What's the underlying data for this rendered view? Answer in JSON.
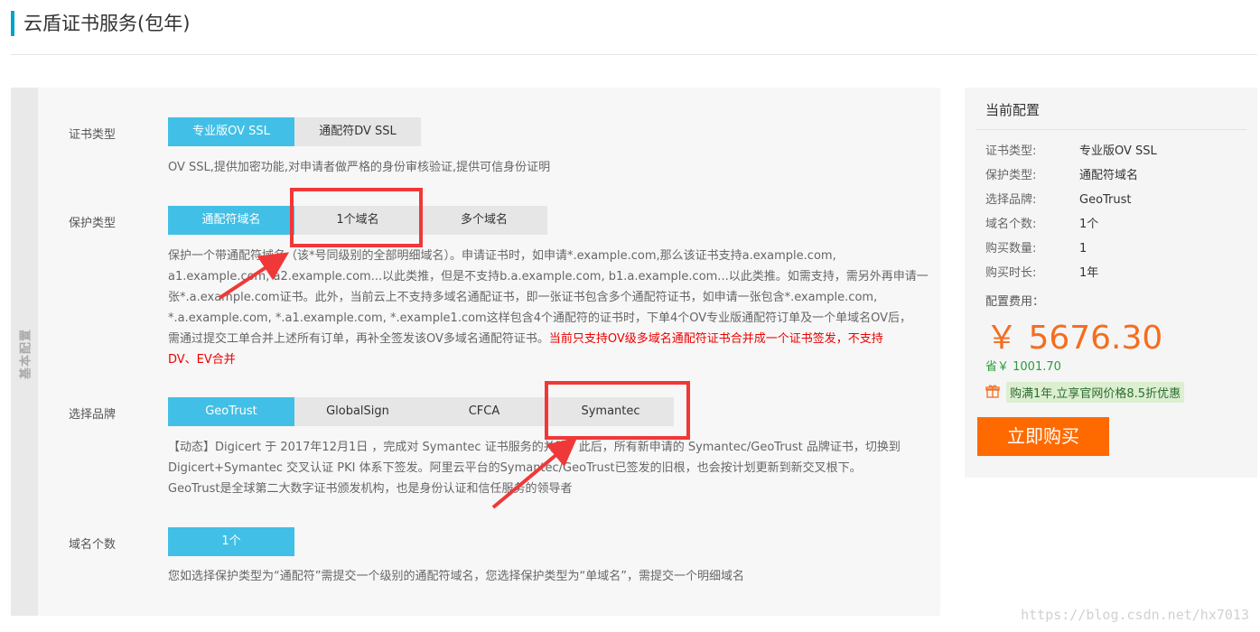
{
  "page": {
    "title": "云盾证书服务(包年)"
  },
  "panel": {
    "side_label": "基本配置"
  },
  "cert_type": {
    "label": "证书类型",
    "options": [
      "专业版OV SSL",
      "通配符DV SSL"
    ],
    "desc": "OV SSL,提供加密功能,对申请者做严格的身份审核验证,提供可信身份证明"
  },
  "protect_type": {
    "label": "保护类型",
    "options": [
      "通配符域名",
      "1个域名",
      "多个域名"
    ],
    "desc_lines": [
      "保护一个带通配符域名（该*号同级别的全部明细域名）。申请证书时，如申请*.example.com,那么该证书支持a.example.com,",
      "a1.example.com, a2.example.com...以此类推，但是不支持b.a.example.com, b1.a.example.com...以此类推。如需支持，需另外再申请一",
      "张*.a.example.com证书。此外，当前云上不支持多域名通配证书，即一张证书包含多个通配符证书，如申请一张包含*.example.com,",
      "*.a.example.com, *.a1.example.com, *.example1.com这样包含4个通配符的证书时，下单4个OV专业版通配符订单及一个单域名OV后，"
    ],
    "desc_line5": "需通过提交工单合并上述所有订单，再补全签发该OV多域名通配符证书。",
    "desc_warn_a": "当前只支持OV级多域名通配符证书合并成一个证书签发，不支持",
    "desc_warn_b": "DV、EV合并"
  },
  "brand": {
    "label": "选择品牌",
    "options": [
      "GeoTrust",
      "GlobalSign",
      "CFCA",
      "Symantec"
    ],
    "desc_lines": [
      "【动态】Digicert 于 2017年12月1日 ，完成对 Symantec 证书服务的并购。此后，所有新申请的 Symantec/GeoTrust 品牌证书，切换到",
      "Digicert+Symantec 交叉认证 PKI 体系下签发。阿里云平台的Symantec/GeoTrust已签发的旧根，也会按计划更新到新交叉根下。",
      "GeoTrust是全球第二大数字证书颁发机构，也是身份认证和信任服务的领导者"
    ]
  },
  "domain_count": {
    "label": "域名个数",
    "options": [
      "1个"
    ],
    "desc": "您如选择保护类型为“通配符”需提交一个级别的通配符域名，您选择保护类型为“单域名”，需提交一个明细域名"
  },
  "summary": {
    "title": "当前配置",
    "rows": [
      {
        "k": "证书类型:",
        "v": "专业版OV SSL"
      },
      {
        "k": "保护类型:",
        "v": "通配符域名"
      },
      {
        "k": "选择品牌:",
        "v": "GeoTrust"
      },
      {
        "k": "域名个数:",
        "v": "1个"
      },
      {
        "k": "购买数量:",
        "v": "1"
      },
      {
        "k": "购买时长:",
        "v": "1年"
      }
    ],
    "fee_label": "配置费用：",
    "price": "￥ 5676.30",
    "save": "省￥ 1001.70",
    "promo": "购满1年,立享官网价格8.5折优惠",
    "buy_label": "立即购买"
  },
  "watermark": "https://blog.csdn.net/hx7013",
  "colors": {
    "accent": "#42bfe6",
    "price": "#f56d1f",
    "buy": "#ff6a00",
    "annotation": "#f03838",
    "warn": "#e00000"
  },
  "icons": {
    "promo": "gift-icon"
  }
}
